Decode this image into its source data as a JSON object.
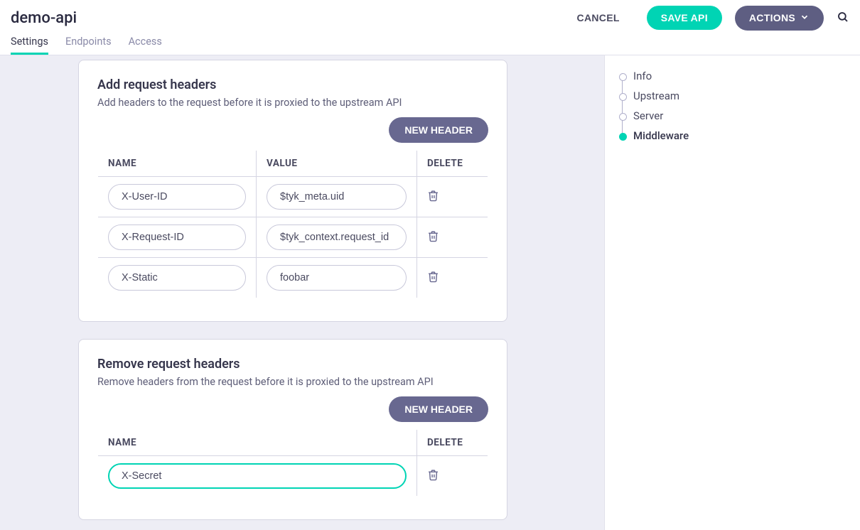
{
  "header": {
    "title": "demo-api",
    "cancel_label": "CANCEL",
    "save_label": "SAVE API",
    "actions_label": "ACTIONS"
  },
  "tabs": [
    {
      "label": "Settings",
      "active": true
    },
    {
      "label": "Endpoints",
      "active": false
    },
    {
      "label": "Access",
      "active": false
    }
  ],
  "sidebar": {
    "items": [
      {
        "label": "Info",
        "active": false
      },
      {
        "label": "Upstream",
        "active": false
      },
      {
        "label": "Server",
        "active": false
      },
      {
        "label": "Middleware",
        "active": true
      }
    ]
  },
  "add_card": {
    "title": "Add request headers",
    "desc": "Add headers to the request before it is proxied to the upstream API",
    "new_header_label": "NEW HEADER",
    "columns": {
      "name": "NAME",
      "value": "VALUE",
      "delete": "DELETE"
    },
    "rows": [
      {
        "name": "X-User-ID",
        "value": "$tyk_meta.uid"
      },
      {
        "name": "X-Request-ID",
        "value": "$tyk_context.request_id"
      },
      {
        "name": "X-Static",
        "value": "foobar"
      }
    ]
  },
  "remove_card": {
    "title": "Remove request headers",
    "desc": "Remove headers from the request before it is proxied to the upstream API",
    "new_header_label": "NEW HEADER",
    "columns": {
      "name": "NAME",
      "delete": "DELETE"
    },
    "rows": [
      {
        "name": "X-Secret",
        "focused": true
      }
    ]
  }
}
